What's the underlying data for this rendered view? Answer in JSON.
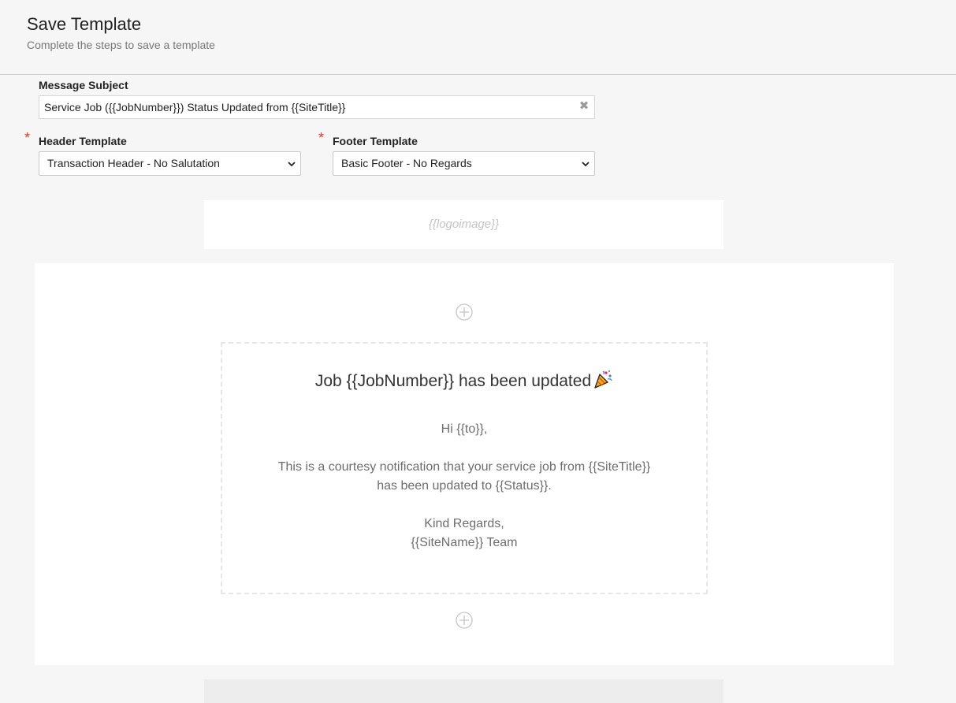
{
  "page": {
    "title": "Save Template",
    "subtitle": "Complete the steps to save a template"
  },
  "form": {
    "subject_label": "Message Subject",
    "subject_value": "Service Job ({{JobNumber}}) Status Updated from {{SiteTitle}}",
    "required_mark": "*",
    "header_label": "Header Template",
    "header_selected": "Transaction Header - No Salutation",
    "footer_label": "Footer Template",
    "footer_selected": "Basic Footer - No Regards"
  },
  "preview": {
    "logo_placeholder": "{{logoimage}}",
    "heading": "Job {{JobNumber}} has been updated",
    "greeting": "Hi {{to}},",
    "message_line1": "This is a courtesy notification that your service job from {{SiteTitle}}",
    "message_line2": "has been updated to {{Status}}.",
    "signoff": "Kind Regards,",
    "signature": "{{SiteName}} Team"
  },
  "icons": {
    "clear": "close-icon",
    "dropdown": "chevron-down-icon",
    "add": "plus-circle-icon",
    "heading_emoji": "party-popper-icon"
  },
  "colors": {
    "required": "#d9412b",
    "background": "#f6f6f6"
  }
}
